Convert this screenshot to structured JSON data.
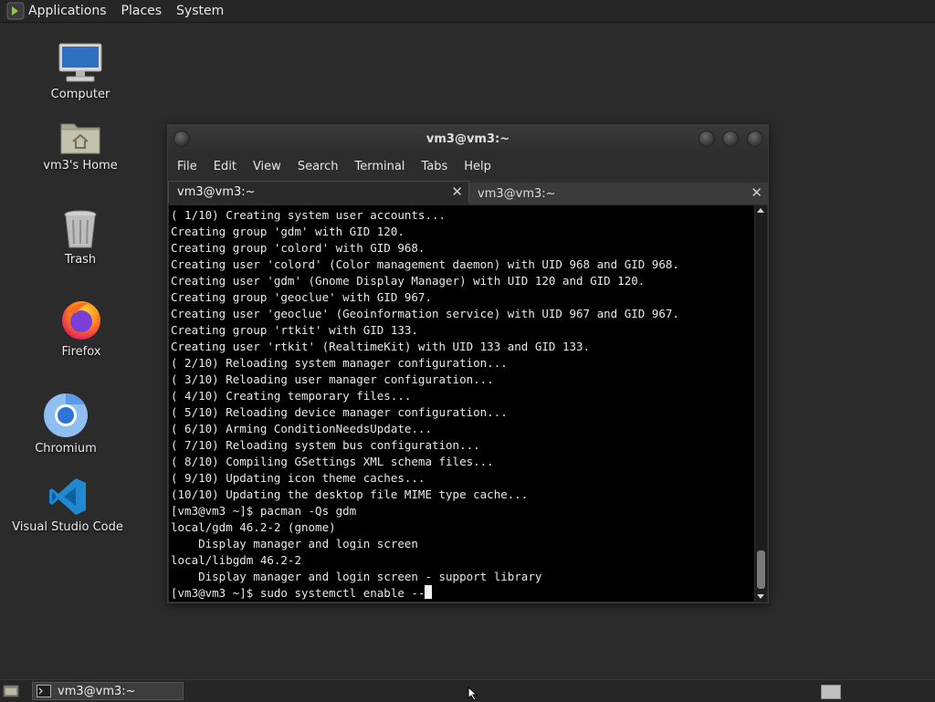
{
  "top_panel": {
    "menus": [
      "Applications",
      "Places",
      "System"
    ]
  },
  "desktop_icons": [
    {
      "label": "Computer",
      "icon": "computer-icon"
    },
    {
      "label": "vm3's Home",
      "icon": "home-folder-icon"
    },
    {
      "label": "Trash",
      "icon": "trash-icon"
    },
    {
      "label": "Firefox",
      "icon": "firefox-icon"
    },
    {
      "label": "Chromium",
      "icon": "chromium-icon"
    },
    {
      "label": "Visual Studio Code",
      "icon": "vscode-icon"
    }
  ],
  "terminal": {
    "title": "vm3@vm3:~",
    "menu": [
      "File",
      "Edit",
      "View",
      "Search",
      "Terminal",
      "Tabs",
      "Help"
    ],
    "tabs": [
      {
        "label": "vm3@vm3:~",
        "active": true
      },
      {
        "label": "vm3@vm3:~",
        "active": false
      }
    ],
    "lines": [
      "( 1/10) Creating system user accounts...",
      "Creating group 'gdm' with GID 120.",
      "Creating group 'colord' with GID 968.",
      "Creating user 'colord' (Color management daemon) with UID 968 and GID 968.",
      "Creating user 'gdm' (Gnome Display Manager) with UID 120 and GID 120.",
      "Creating group 'geoclue' with GID 967.",
      "Creating user 'geoclue' (Geoinformation service) with UID 967 and GID 967.",
      "Creating group 'rtkit' with GID 133.",
      "Creating user 'rtkit' (RealtimeKit) with UID 133 and GID 133.",
      "( 2/10) Reloading system manager configuration...",
      "( 3/10) Reloading user manager configuration...",
      "( 4/10) Creating temporary files...",
      "( 5/10) Reloading device manager configuration...",
      "( 6/10) Arming ConditionNeedsUpdate...",
      "( 7/10) Reloading system bus configuration...",
      "( 8/10) Compiling GSettings XML schema files...",
      "( 9/10) Updating icon theme caches...",
      "(10/10) Updating the desktop file MIME type cache...",
      "[vm3@vm3 ~]$ pacman -Qs gdm",
      "local/gdm 46.2-2 (gnome)",
      "    Display manager and login screen",
      "local/libgdm 46.2-2",
      "    Display manager and login screen - support library"
    ],
    "prompt_line": "[vm3@vm3 ~]$ sudo systemctl enable --"
  },
  "taskbar": {
    "window_button": "vm3@vm3:~"
  },
  "colors": {
    "desktop_bg": "#2b2b2b",
    "panel_bg": "#262626",
    "terminal_bg": "#000000",
    "terminal_fg": "#e8e8e8",
    "vscode_blue": "#1f8ad2",
    "firefox_orange": "#ff8a16",
    "chromium_blue": "#2f74d8"
  }
}
